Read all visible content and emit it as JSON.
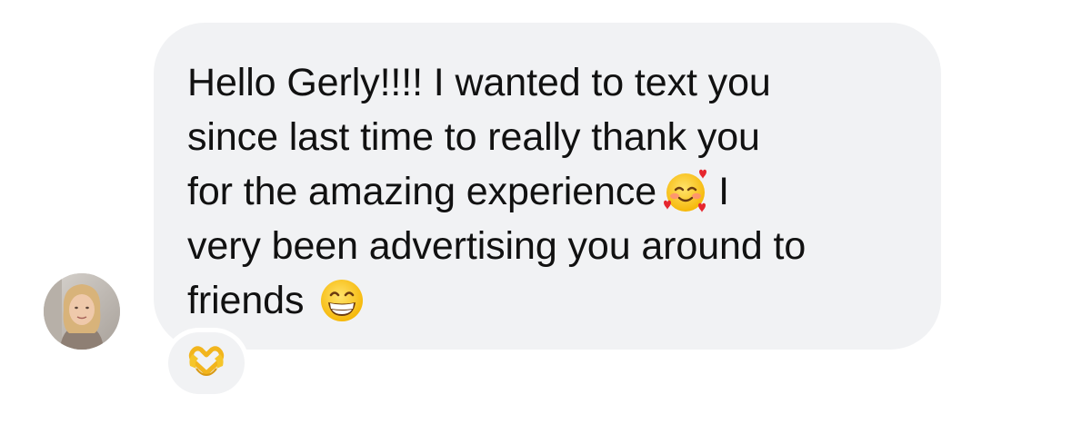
{
  "message": {
    "lines": [
      "Hello Gerly!!!! I wanted to text you",
      "since last time to really thank you",
      "for the amazing experience",
      "I",
      "very been advertising you around to",
      "friends"
    ],
    "emoji_1": "smiling-face-with-hearts-icon",
    "emoji_2": "grinning-face-icon"
  },
  "reaction": {
    "emoji": "heart-hands-icon"
  },
  "colors": {
    "bubble_background": "#f1f2f4",
    "text": "#111111",
    "page_background": "#ffffff"
  }
}
